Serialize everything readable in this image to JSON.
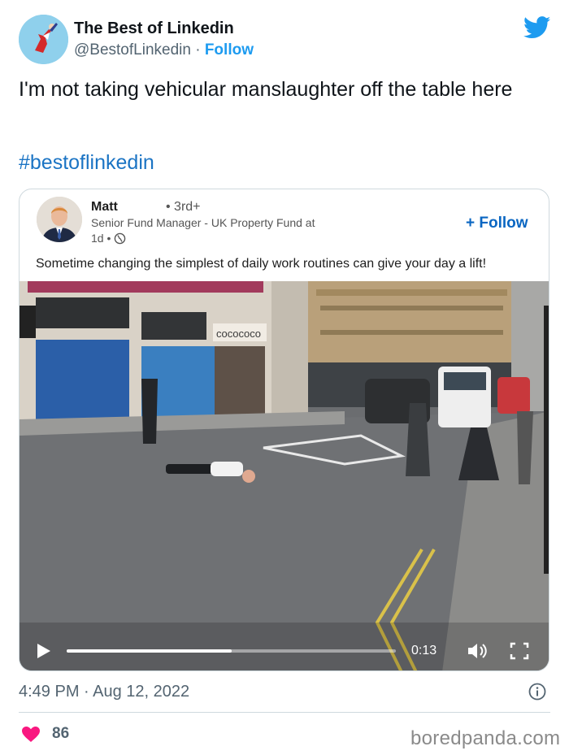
{
  "author": {
    "name": "The Best of Linkedin",
    "handle": "@BestofLinkedin",
    "separator": "·",
    "follow_label": "Follow"
  },
  "tweet": {
    "text": "I'm not taking vehicular manslaughter off the table here",
    "hashtag": "#bestoflinkedin"
  },
  "linkedin_post": {
    "name": "Matt",
    "degree": "• 3rd+",
    "title": "Senior Fund Manager - UK Property Fund at",
    "time": "1d •",
    "follow_label": "+ Follow",
    "text": "Sometime changing the simplest of daily work routines can give your day a lift!",
    "video": {
      "shop_sign": "cocococo",
      "current_time": "0:13",
      "progress_fraction": 0.5
    }
  },
  "footer": {
    "timestamp": "4:49 PM · Aug 12, 2022",
    "likes": "86"
  },
  "watermark": "boredpanda.com",
  "colors": {
    "twitter_blue": "#1d9bf0",
    "hashtag_blue": "#1b74c4",
    "linkedin_blue": "#0a66c2",
    "heart_pink": "#f91880"
  },
  "icons": [
    "twitter-bird-icon",
    "globe-icon",
    "play-icon",
    "volume-icon",
    "fullscreen-icon",
    "info-icon",
    "heart-icon"
  ]
}
